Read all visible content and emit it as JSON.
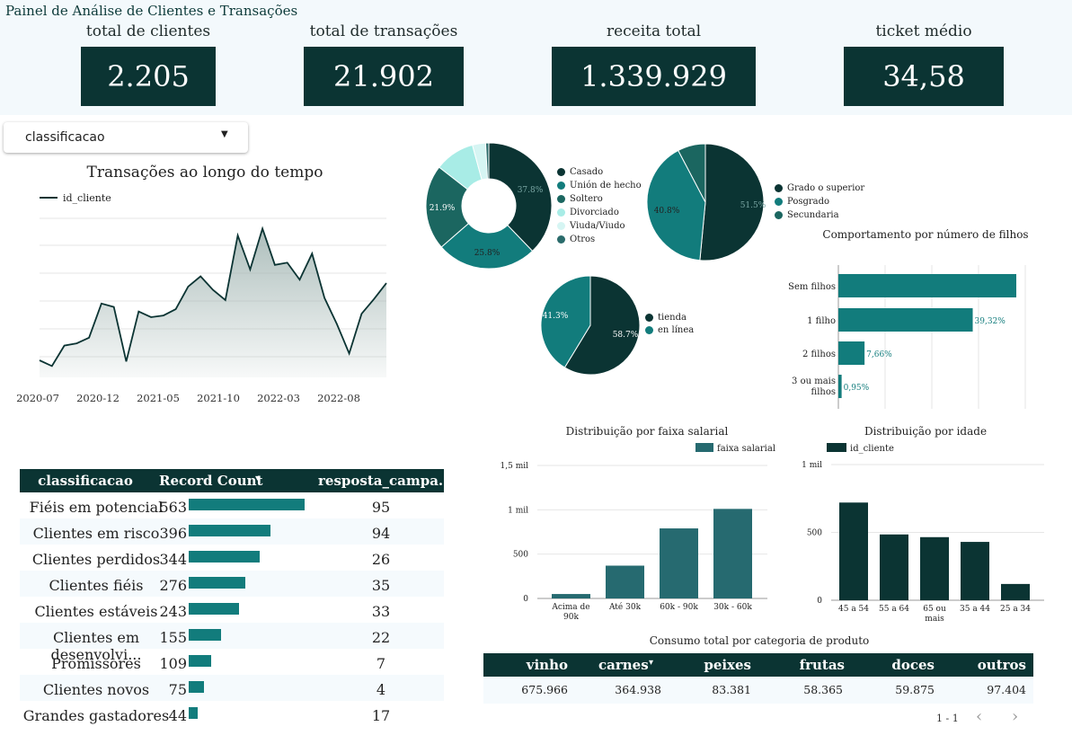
{
  "title": "Painel de Análise de Clientes e Transações",
  "kpis": [
    {
      "label": "total de clientes",
      "value": "2.205"
    },
    {
      "label": "total de transações",
      "value": "21.902"
    },
    {
      "label": "receita total",
      "value": "1.339.929"
    },
    {
      "label": "ticket médio",
      "value": "34,58"
    }
  ],
  "filter": {
    "label": "classificacao"
  },
  "line_chart": {
    "title": "Transações ao longo do tempo",
    "legend": "id_cliente"
  },
  "marital_legend": [
    "Casado",
    "Unión de hecho",
    "Soltero",
    "Divorciado",
    "Viuda/Viudo",
    "Otros"
  ],
  "education_legend": [
    "Grado o superior",
    "Posgrado",
    "Secundaria"
  ],
  "channel_legend": [
    "tienda",
    "en línea"
  ],
  "children_chart": {
    "title": "Comportamento por número de filhos"
  },
  "salary_chart": {
    "title": "Distribuição por faixa salarial",
    "legend": "faixa salarial"
  },
  "age_chart": {
    "title": "Distribuição por idade",
    "legend": "id_cliente"
  },
  "class_table": {
    "headers": [
      "classificacao",
      "Record Count",
      "resposta_campa..."
    ],
    "sort_icon": "▾",
    "rows": [
      {
        "name": "Fiéis em potencial",
        "count": "563",
        "resp": "95"
      },
      {
        "name": "Clientes em risco",
        "count": "396",
        "resp": "94"
      },
      {
        "name": "Clientes perdidos",
        "count": "344",
        "resp": "26"
      },
      {
        "name": "Clientes fiéis",
        "count": "276",
        "resp": "35"
      },
      {
        "name": "Clientes estáveis",
        "count": "243",
        "resp": "33"
      },
      {
        "name": "Clientes em desenvolvi...",
        "count": "155",
        "resp": "22"
      },
      {
        "name": "Promissores",
        "count": "109",
        "resp": "7"
      },
      {
        "name": "Clientes novos",
        "count": "75",
        "resp": "4"
      },
      {
        "name": "Grandes gastadores",
        "count": "44",
        "resp": "17"
      }
    ]
  },
  "consumo": {
    "title": "Consumo total por categoria de produto",
    "headers": [
      "vinho",
      "carnes",
      "peixes",
      "frutas",
      "doces",
      "outros"
    ],
    "sort_icon": "▾",
    "values": [
      "675.966",
      "364.938",
      "83.381",
      "58.365",
      "59.875",
      "97.404"
    ],
    "pager": "1 - 1"
  },
  "chart_data": [
    {
      "type": "area",
      "title": "Transações ao longo do tempo",
      "series": [
        {
          "name": "id_cliente",
          "values": [
            150,
            100,
            280,
            300,
            350,
            650,
            620,
            140,
            580,
            530,
            545,
            600,
            800,
            890,
            770,
            680,
            1250,
            950,
            1310,
            990,
            1010,
            860,
            1090,
            700,
            470,
            210,
            560,
            690,
            830
          ]
        }
      ],
      "x_ticks": [
        "2020-07",
        "2020-12",
        "2021-05",
        "2021-10",
        "2022-03",
        "2022-08"
      ]
    },
    {
      "type": "pie",
      "labels": [
        "Casado",
        "Unión de hecho",
        "Soltero",
        "Divorciado",
        "Viuda/Viudo",
        "Otros"
      ],
      "values": [
        37.8,
        25.8,
        21.9,
        10.3,
        3.4,
        0.8
      ],
      "data_labels": [
        "37.8%",
        "25.8%",
        "21.9%"
      ]
    },
    {
      "type": "pie",
      "labels": [
        "Grado o superior",
        "Posgrado",
        "Secundaria"
      ],
      "values": [
        51.5,
        40.8,
        7.7
      ],
      "data_labels": [
        "51.5%",
        "40.8%"
      ]
    },
    {
      "type": "pie",
      "labels": [
        "tienda",
        "en línea"
      ],
      "values": [
        58.7,
        41.3
      ],
      "data_labels": [
        "58.7%",
        "41.3%"
      ]
    },
    {
      "type": "bar",
      "title": "Comportamento por número de filhos",
      "categories": [
        "Sem filhos",
        "1 filho",
        "2 filhos",
        "3 ou mais filhos"
      ],
      "values": [
        52.07,
        39.32,
        7.66,
        0.95
      ],
      "data_labels": [
        "",
        "39,32%",
        "7,66%",
        "0,95%"
      ]
    },
    {
      "type": "bar",
      "title": "Distribuição por faixa salarial",
      "categories": [
        "Acima de 90k",
        "Até 30k",
        "60k - 90k",
        "30k - 60k"
      ],
      "series": [
        {
          "name": "faixa salarial",
          "values": [
            50,
            370,
            790,
            1010
          ]
        }
      ],
      "y_ticks": [
        "0",
        "500",
        "1 mil",
        "1,5 mil"
      ],
      "ylim": [
        0,
        1500
      ]
    },
    {
      "type": "bar",
      "title": "Distribuição por idade",
      "categories": [
        "45 a 54",
        "55 a 64",
        "65 ou mais",
        "35 a 44",
        "25 a 34"
      ],
      "series": [
        {
          "name": "id_cliente",
          "values": [
            720,
            485,
            465,
            430,
            120
          ]
        }
      ],
      "y_ticks": [
        "0",
        "500",
        "1 mil"
      ],
      "ylim": [
        0,
        1000
      ]
    }
  ],
  "colors": {
    "dark": "#0b3433",
    "teal": "#127c7c",
    "mid": "#1b6660",
    "salary": "#266a70"
  }
}
